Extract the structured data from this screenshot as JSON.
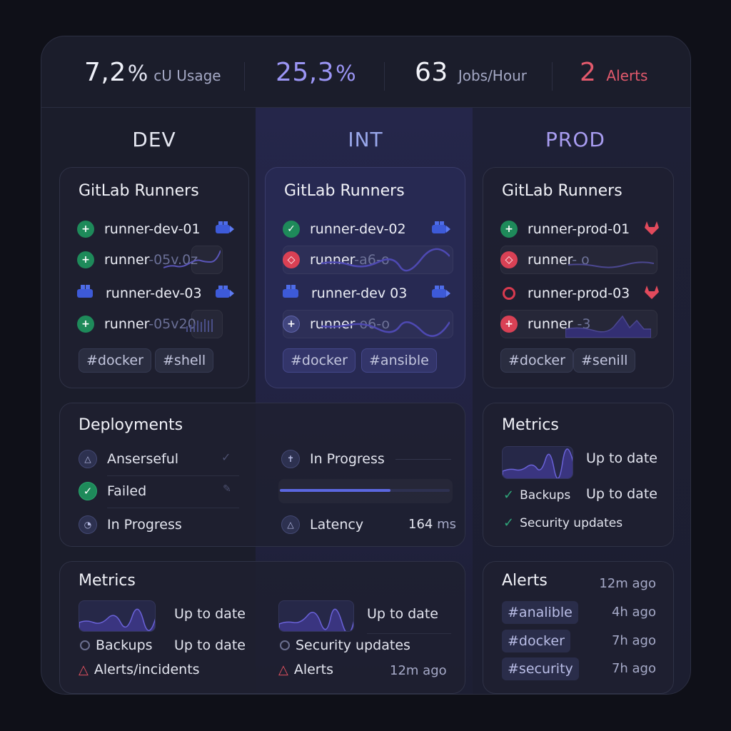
{
  "stats": {
    "cpu": {
      "value": "7,2",
      "unit": "%",
      "label": "cU Usage"
    },
    "mem": {
      "value": "25,3",
      "unit": "%"
    },
    "jobs": {
      "value": "63",
      "label": "Jobs/Hour"
    },
    "alerts": {
      "value": "2",
      "label": "Alerts"
    }
  },
  "columns": {
    "dev": "DEV",
    "int": "INT",
    "prod": "PROD"
  },
  "runners": {
    "dev": {
      "title": "GitLab Runners",
      "items": [
        {
          "name": "runner-dev-01",
          "faded": ""
        },
        {
          "name": "runner",
          "faded": "-05v.0z"
        },
        {
          "name": "runner-dev-03",
          "faded": ""
        },
        {
          "name": "runner",
          "faded": "-05v20"
        }
      ],
      "tags": [
        "#docker",
        "#shell"
      ]
    },
    "int": {
      "title": "GitLab Runners",
      "items": [
        {
          "name": "runner-dev-02",
          "faded": ""
        },
        {
          "name": "runner",
          "faded": "-a6-o"
        },
        {
          "name": "runner-dev 03",
          "faded": ""
        },
        {
          "name": "runner",
          "faded": "o6-o"
        }
      ],
      "tags": [
        "#docker",
        "#ansible"
      ]
    },
    "prod": {
      "title": "GitLab Runners",
      "items": [
        {
          "name": "runner-prod-01",
          "faded": ""
        },
        {
          "name": "runner",
          "faded": "- o"
        },
        {
          "name": "runner-prod-03",
          "faded": ""
        },
        {
          "name": "runner",
          "faded": "-3"
        }
      ],
      "tags": [
        "#docker",
        "#senill"
      ]
    }
  },
  "deployments": {
    "title": "Deployments",
    "left": [
      {
        "label": "Anserseful"
      },
      {
        "label": "Failed"
      },
      {
        "label": "In Progress"
      }
    ],
    "right": {
      "in_progress": "In Progress",
      "progress": 0.65,
      "latency_label": "Latency",
      "latency_value": "164",
      "latency_unit": "ms"
    }
  },
  "metrics_prod": {
    "title": "Metrics",
    "status1": "Up to date",
    "backups": "Backups",
    "status2": "Up to date",
    "security": "Security updates"
  },
  "metrics_bottom": {
    "title": "Metrics",
    "left": {
      "status1": "Up to date",
      "backups": "Backups",
      "status2": "Up to date",
      "alerts": "Alerts/incidents"
    },
    "right": {
      "status1": "Up to date",
      "security": "Security updates",
      "alerts": "Alerts",
      "time": "12m ago"
    }
  },
  "alerts_card": {
    "title": "Alerts",
    "title_time": "12m ago",
    "items": [
      {
        "tag": "#analible",
        "time": "4h ago"
      },
      {
        "tag": "#docker",
        "time": "7h ago"
      },
      {
        "tag": "#security",
        "time": "7h ago"
      }
    ]
  },
  "colors": {
    "accent": "#8b84f2",
    "alert": "#e2596c",
    "ok": "#1e8a5a",
    "bg": "#1b1d2b"
  }
}
